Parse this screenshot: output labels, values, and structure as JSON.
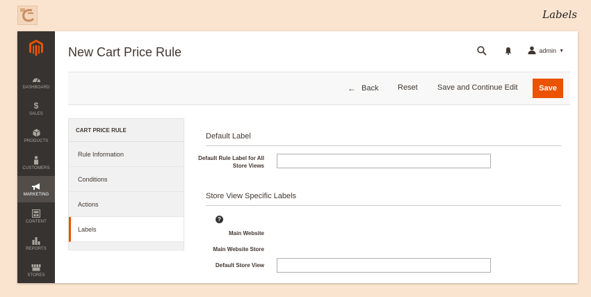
{
  "page_label": "Labels",
  "sidebar": {
    "items": [
      {
        "label": "DASHBOARD",
        "icon": "dashboard-icon"
      },
      {
        "label": "SALES",
        "icon": "dollar-icon"
      },
      {
        "label": "PRODUCTS",
        "icon": "box-icon"
      },
      {
        "label": "CUSTOMERS",
        "icon": "person-icon"
      },
      {
        "label": "MARKETING",
        "icon": "megaphone-icon",
        "active": true
      },
      {
        "label": "CONTENT",
        "icon": "content-icon"
      },
      {
        "label": "REPORTS",
        "icon": "bar-chart-icon"
      },
      {
        "label": "STORES",
        "icon": "store-icon"
      }
    ]
  },
  "header": {
    "title": "New Cart Price Rule",
    "user": "admin"
  },
  "actions": {
    "back": "Back",
    "reset": "Reset",
    "save_continue": "Save and Continue Edit",
    "save": "Save"
  },
  "tabs": {
    "heading": "CART PRICE RULE",
    "items": [
      "Rule Information",
      "Conditions",
      "Actions",
      "Labels"
    ],
    "active": "Labels"
  },
  "default_label": {
    "title": "Default Label",
    "field_label": "Default Rule Label for All Store Views",
    "value": ""
  },
  "store_labels": {
    "title": "Store View Specific Labels",
    "website": "Main Website",
    "store": "Main Website Store",
    "view_label": "Default Store View",
    "view_value": ""
  },
  "colors": {
    "accent": "#eb5202",
    "sidebar": "#373330",
    "sidebar_active": "#524d49",
    "background": "#fbe4cf"
  }
}
